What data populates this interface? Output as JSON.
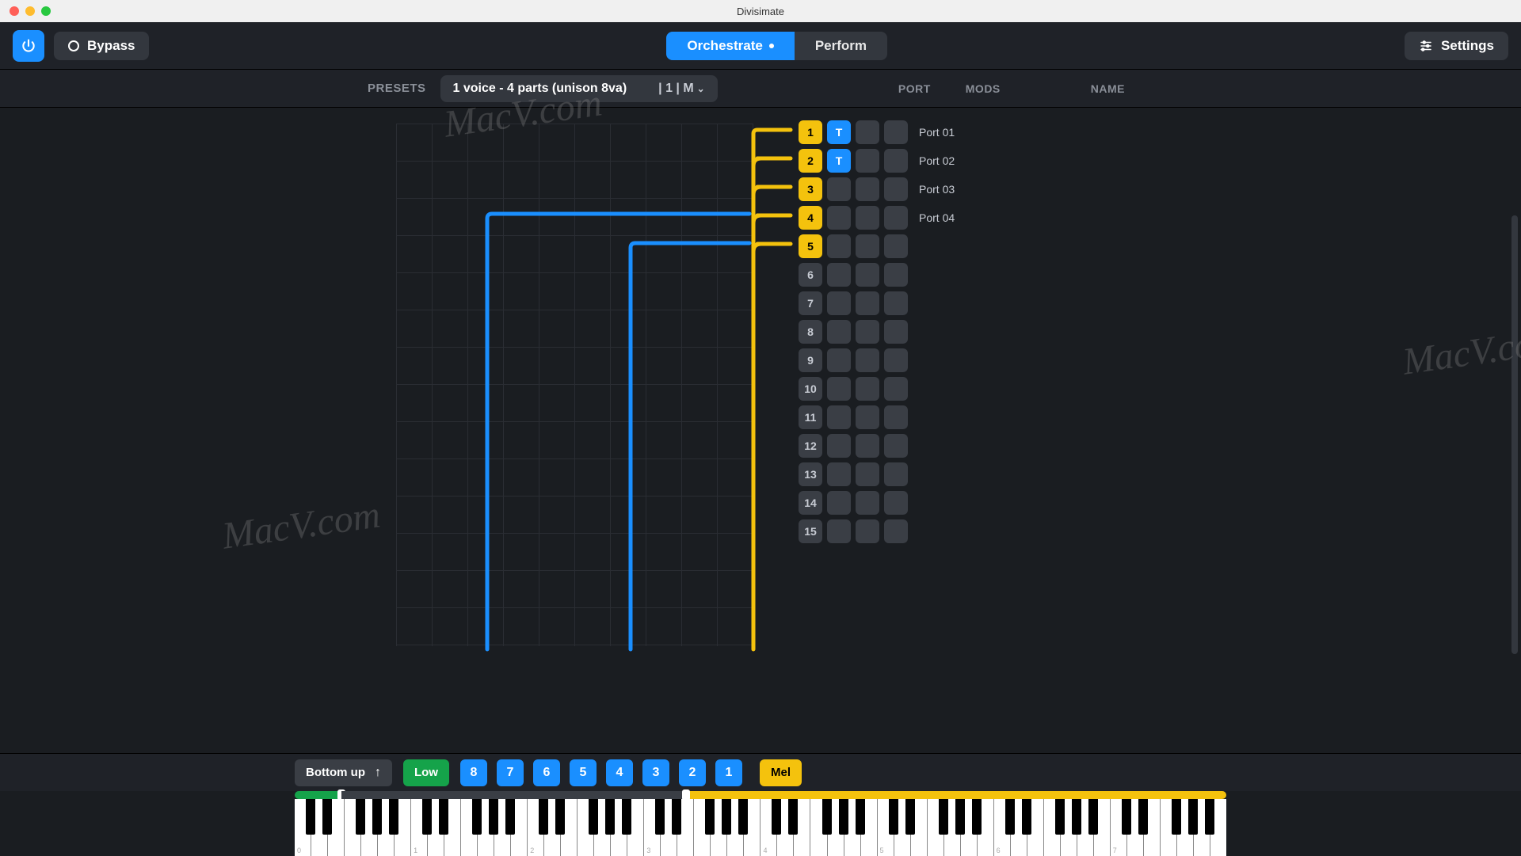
{
  "window": {
    "title": "Divisimate"
  },
  "header": {
    "bypass_label": "Bypass",
    "tabs": {
      "orchestrate": "Orchestrate",
      "perform": "Perform"
    },
    "settings_label": "Settings"
  },
  "presets": {
    "label": "PRESETS",
    "current": "1 voice - 4 parts (unison 8va)",
    "meta": "| 1 | M"
  },
  "columns": {
    "port": "PORT",
    "mods": "MODS",
    "name": "NAME"
  },
  "ports": [
    {
      "num": "1",
      "active": true,
      "t": true,
      "name": "Port 01"
    },
    {
      "num": "2",
      "active": true,
      "t": true,
      "name": "Port 02"
    },
    {
      "num": "3",
      "active": true,
      "t": false,
      "name": "Port 03"
    },
    {
      "num": "4",
      "active": true,
      "t": false,
      "name": "Port 04"
    },
    {
      "num": "5",
      "active": true,
      "t": false,
      "name": ""
    },
    {
      "num": "6",
      "active": false,
      "t": false,
      "name": ""
    },
    {
      "num": "7",
      "active": false,
      "t": false,
      "name": ""
    },
    {
      "num": "8",
      "active": false,
      "t": false,
      "name": ""
    },
    {
      "num": "9",
      "active": false,
      "t": false,
      "name": ""
    },
    {
      "num": "10",
      "active": false,
      "t": false,
      "name": ""
    },
    {
      "num": "11",
      "active": false,
      "t": false,
      "name": ""
    },
    {
      "num": "12",
      "active": false,
      "t": false,
      "name": ""
    },
    {
      "num": "13",
      "active": false,
      "t": false,
      "name": ""
    },
    {
      "num": "14",
      "active": false,
      "t": false,
      "name": ""
    },
    {
      "num": "15",
      "active": false,
      "t": false,
      "name": ""
    }
  ],
  "bottom": {
    "bottom_up_label": "Bottom up",
    "low_label": "Low",
    "voices": [
      "8",
      "7",
      "6",
      "5",
      "4",
      "3",
      "2",
      "1"
    ],
    "mel_label": "Mel"
  },
  "octaves": [
    "0",
    "1",
    "2",
    "3",
    "4",
    "5",
    "6",
    "7"
  ],
  "watermark": "MacV.com",
  "colors": {
    "accent_blue": "#1a8fff",
    "accent_yellow": "#f4c20d",
    "accent_green": "#15a34a"
  }
}
